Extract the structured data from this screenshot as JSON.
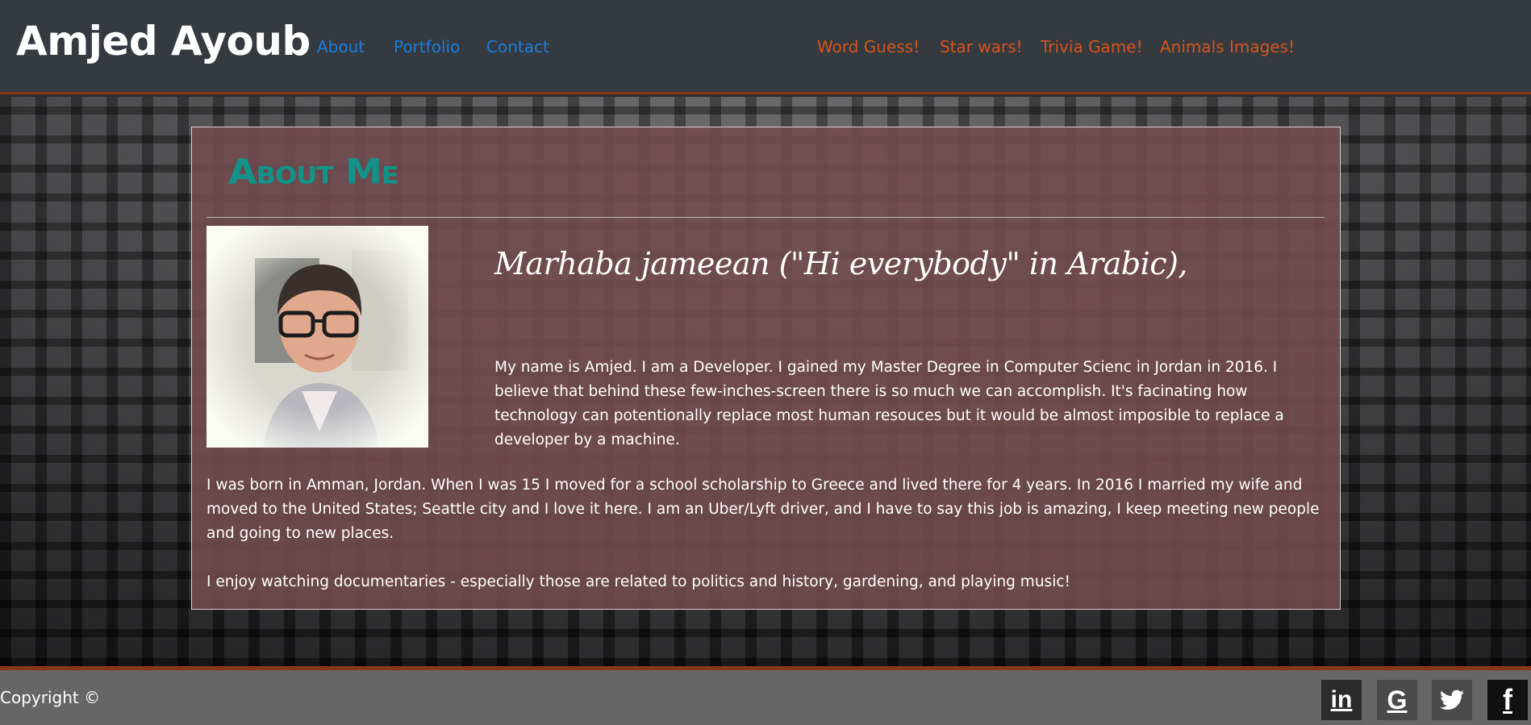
{
  "header": {
    "brand": "Amjed Ayoub",
    "nav_left": [
      "About",
      "Portfolio",
      "Contact"
    ],
    "nav_right": [
      "Word Guess!",
      "Star wars!",
      "Trivia Game!",
      "Animals Images!"
    ]
  },
  "about": {
    "title": "About Me",
    "greeting": "Marhaba jameean (\"Hi everybody\" in Arabic),",
    "paragraph_1": "My name is Amjed. I am a Developer. I gained my Master Degree in Computer Scienc in Jordan in 2016. I believe that behind these few-inches-screen there is so much we can accomplish. It's facinating how technology can potentionally replace most human resouces but it would be almost imposible to replace a developer by a machine.",
    "paragraph_2": "I was born in Amman, Jordan. When I was 15 I moved for a school scholarship to Greece and lived there for 4 years. In 2016 I married my wife and moved to the United States; Seattle city and I love it here. I am an Uber/Lyft driver, and I have to say this job is amazing, I keep meeting new people and going to new places.",
    "paragraph_3": "I enjoy watching documentaries - especially those are related to politics and history, gardening, and playing music!"
  },
  "footer": {
    "copyright": "Copyright ©",
    "social": [
      {
        "name": "linkedin-icon",
        "glyph": "in"
      },
      {
        "name": "google-icon",
        "glyph": "G"
      },
      {
        "name": "twitter-icon",
        "glyph": ""
      },
      {
        "name": "facebook-icon",
        "glyph": "f"
      }
    ]
  },
  "colors": {
    "header_bg": "#343a40",
    "nav_link": "#1a7ddc",
    "nav_link_alt": "#d4541c",
    "accent_border": "#8a3516",
    "about_title": "#12938a",
    "card_bg": "#734b4e",
    "footer_bg": "#666666"
  }
}
